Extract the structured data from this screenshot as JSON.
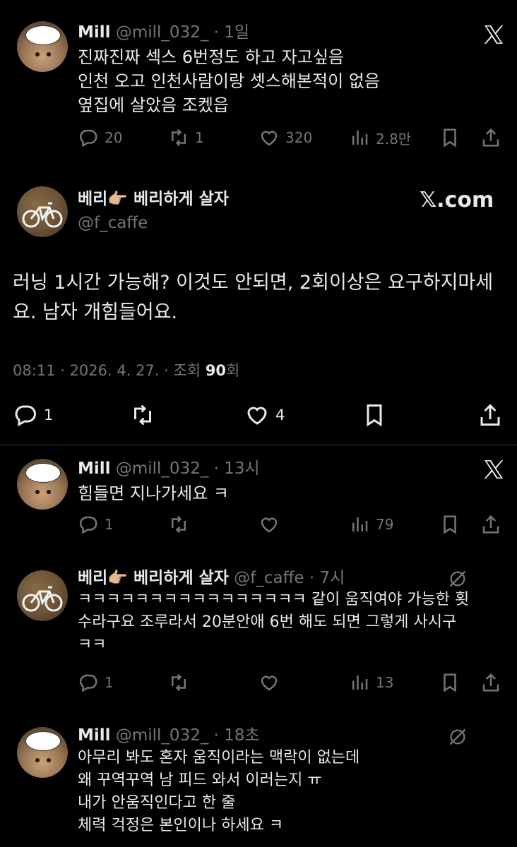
{
  "tweet1": {
    "name": "Mill",
    "handle": "@mill_032_",
    "sep": "·",
    "time": "1일",
    "lines": [
      "진짜진짜 섹스 6번정도 하고 자고싶음",
      "인천 오고 인천사람이랑 셋스해본적이 없음",
      "옆집에 살았음 조켔읍"
    ],
    "replies": "20",
    "reposts": "1",
    "likes": "320",
    "views": "2.8만"
  },
  "main": {
    "name": "베리👉🏼 베리하게 살자",
    "handle": "@f_caffe",
    "brand": "𝕏.com",
    "text": "러닝 1시간 가능해? 이것도 안되면, 2회이상은 요구하지마세요. 남자 개힘들어요.",
    "meta_time": "08:11 · 2026. 4. 27. · 조회",
    "meta_views": "90",
    "meta_unit": "회",
    "replies": "1",
    "likes": "4"
  },
  "reply1": {
    "name": "Mill",
    "handle": "@mill_032_",
    "sep": "·",
    "time": "13시",
    "text": "힘들면 지나가세요 ㅋ",
    "replies": "1",
    "views": "79"
  },
  "reply2": {
    "name": "베리👉🏼 베리하게 살자",
    "handle": "@f_caffe",
    "sep": "·",
    "time": "7시",
    "lines": [
      "ㅋㅋㅋㅋㅋㅋㅋㅋㅋㅋㅋㅋㅋㅋㅋㅋ 같이 움직여야 가능한 횟",
      "수라구요 조루라서 20분안애 6번 해도 되면 그렇게 사시구",
      "ㅋㅋ"
    ],
    "replies": "1",
    "views": "13"
  },
  "reply3": {
    "name": "Mill",
    "handle": "@mill_032_",
    "sep": "·",
    "time": "18초",
    "lines": [
      "아무리 봐도 혼자 움직이라는 맥락이 없는데",
      "왜 꾸역꾸역 남 피드 와서 이러는지 ㅠ",
      "내가 안움직인다고 한 줄",
      "체력 걱정은 본인이나 하세요 ㅋ"
    ]
  },
  "icons": {
    "reply": "reply-icon",
    "repost": "repost-icon",
    "like": "heart-icon",
    "views": "views-icon",
    "bookmark": "bookmark-icon",
    "share": "share-icon",
    "x_logo": "x-logo-icon",
    "grok": "grok-icon"
  }
}
